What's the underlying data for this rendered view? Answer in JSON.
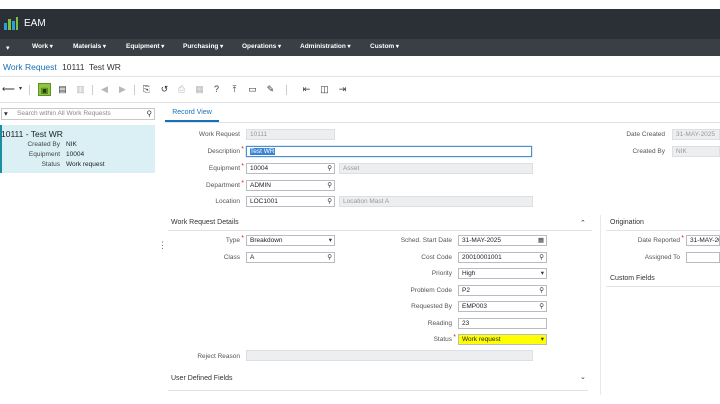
{
  "app": {
    "name": "EAM"
  },
  "menu": [
    "Work",
    "Materials",
    "Equipment",
    "Purchasing",
    "Operations",
    "Administration",
    "Custom"
  ],
  "breadcrumb": {
    "module": "Work Request",
    "id": "10111",
    "title": "Test WR"
  },
  "search": {
    "placeholder": "Search within All Work Requests"
  },
  "list": {
    "title": "10111 - Test WR",
    "created_by_label": "Created By",
    "created_by": "NIK",
    "equipment_label": "Equipment",
    "equipment": "10004",
    "status_label": "Status",
    "status": "Work request"
  },
  "tabs": {
    "record_view": "Record View"
  },
  "header": {
    "work_request_label": "Work Request",
    "work_request": "10111",
    "description_label": "Description",
    "description": "Test WR",
    "equipment_label": "Equipment",
    "equipment": "10004",
    "equipment_desc": "Asset",
    "department_label": "Department",
    "department": "ADMIN",
    "location_label": "Location",
    "location": "LOC1001",
    "location_desc": "Location Mast A",
    "date_created_label": "Date Created",
    "date_created": "31-MAY-2025",
    "created_by_label": "Created By",
    "created_by": "NIK"
  },
  "details": {
    "section_title": "Work Request Details",
    "type_label": "Type",
    "type": "Breakdown",
    "class_label": "Class",
    "class": "A",
    "sched_start_label": "Sched. Start Date",
    "sched_start": "31-MAY-2025",
    "cost_code_label": "Cost Code",
    "cost_code": "20010001001",
    "priority_label": "Priority",
    "priority": "High",
    "problem_code_label": "Problem Code",
    "problem_code": "P2",
    "requested_by_label": "Requested By",
    "requested_by": "EMP003",
    "reading_label": "Reading",
    "reading": "23",
    "status_label": "Status",
    "status": "Work request",
    "reject_reason_label": "Reject Reason",
    "reject_reason": ""
  },
  "origination": {
    "section_title": "Origination",
    "date_reported_label": "Date Reported",
    "date_reported": "31-MAY-20",
    "assigned_to_label": "Assigned To",
    "assigned_to": ""
  },
  "custom_fields": {
    "section_title": "Custom Fields"
  },
  "user_defined": {
    "section_title": "User Defined Fields"
  },
  "colors": {
    "appbar": "#2b3037",
    "accent": "#1a6fb5",
    "status_highlight": "#ffff00",
    "save_button": "#8ec641"
  }
}
